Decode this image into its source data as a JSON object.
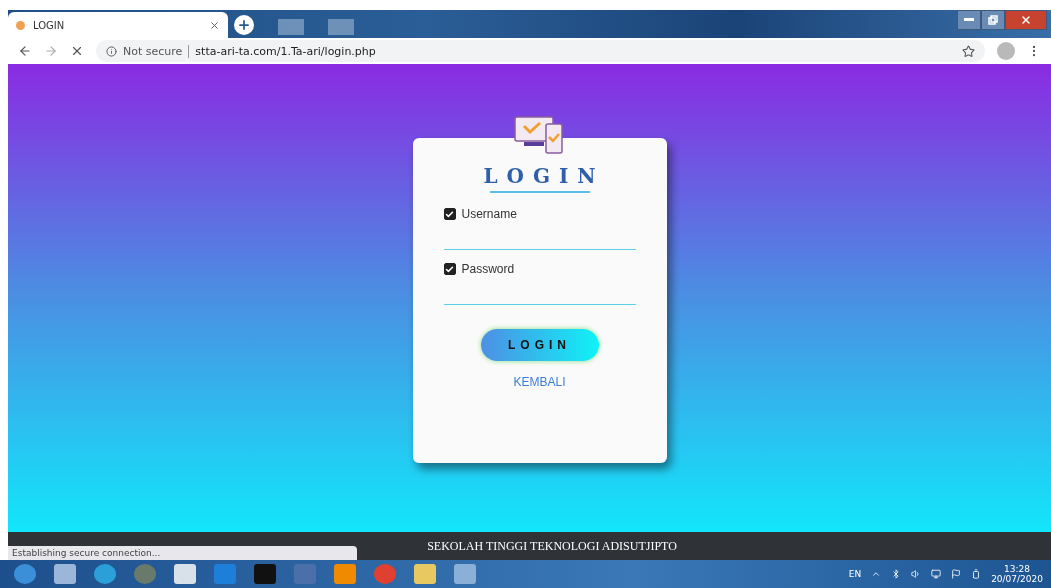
{
  "browser": {
    "tab_title": "LOGIN",
    "security": "Not secure",
    "url": "stta-ari-ta.com/1.Ta-ari/login.php"
  },
  "login": {
    "title": "LOGIN",
    "fields": [
      {
        "label": "Username",
        "checked": true
      },
      {
        "label": "Password",
        "checked": true
      }
    ],
    "button": "LOGIN",
    "link": "KEMBALI"
  },
  "footer": {
    "text": "SEKOLAH TINGGI TEKNOLOGI ADISUTJIPTO"
  },
  "status_bar": {
    "text": "Establishing secure connection..."
  },
  "taskbar": {
    "language": "EN",
    "time": "13:28",
    "date": "20/07/2020"
  }
}
